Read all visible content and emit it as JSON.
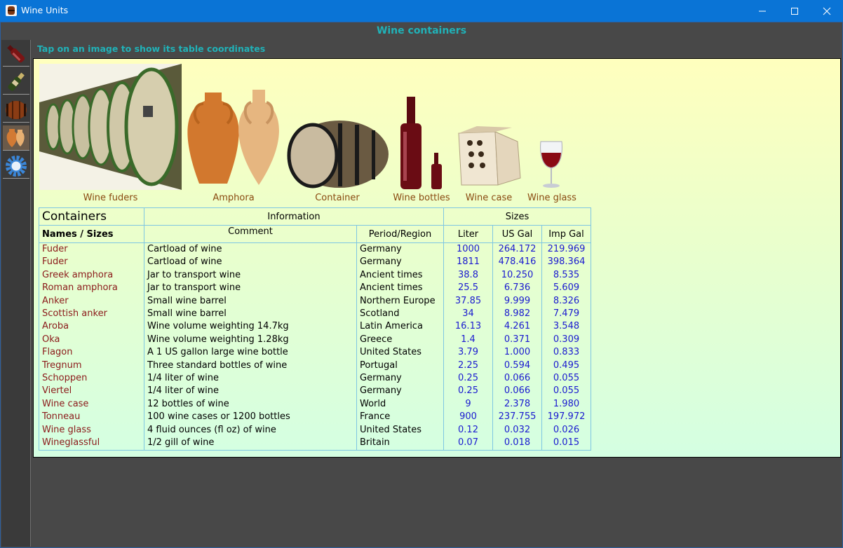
{
  "window": {
    "title": "Wine Units"
  },
  "page": {
    "title": "Wine containers",
    "hint": "Tap on an image to show its table coordinates"
  },
  "sidebar": {
    "items": [
      {
        "icon": "wine-bottle-red-icon"
      },
      {
        "icon": "wine-bottle-green-icon"
      },
      {
        "icon": "barrel-icon"
      },
      {
        "icon": "amphora-icon"
      },
      {
        "icon": "settings-gear-icon"
      }
    ]
  },
  "images": [
    {
      "caption": "Wine fuders"
    },
    {
      "caption": "Amphora"
    },
    {
      "caption": "Container"
    },
    {
      "caption": "Wine bottles"
    },
    {
      "caption": "Wine case"
    },
    {
      "caption": "Wine glass"
    }
  ],
  "table": {
    "group_headers": {
      "containers": "Containers",
      "information": "Information",
      "sizes": "Sizes"
    },
    "columns": {
      "names": "Names / Sizes",
      "comment": "Comment",
      "period": "Period/Region",
      "liter": "Liter",
      "usgal": "US Gal",
      "impgal": "Imp Gal"
    },
    "rows": [
      {
        "name": "Fuder",
        "comment": "Cartload of wine",
        "period": "Germany",
        "liter": "1000",
        "usgal": "264.172",
        "impgal": "219.969"
      },
      {
        "name": "Fuder",
        "comment": "Cartload of wine",
        "period": "Germany",
        "liter": "1811",
        "usgal": "478.416",
        "impgal": "398.364"
      },
      {
        "name": "Greek amphora",
        "comment": "Jar to transport wine",
        "period": "Ancient times",
        "liter": "38.8",
        "usgal": "10.250",
        "impgal": "8.535"
      },
      {
        "name": "Roman amphora",
        "comment": "Jar to transport wine",
        "period": "Ancient times",
        "liter": "25.5",
        "usgal": "6.736",
        "impgal": "5.609"
      },
      {
        "name": "Anker",
        "comment": "Small wine barrel",
        "period": "Northern Europe",
        "liter": "37.85",
        "usgal": "9.999",
        "impgal": "8.326"
      },
      {
        "name": "Scottish anker",
        "comment": "Small wine barrel",
        "period": "Scotland",
        "liter": "34",
        "usgal": "8.982",
        "impgal": "7.479"
      },
      {
        "name": "Aroba",
        "comment": "Wine volume weighting 14.7kg",
        "period": "Latin America",
        "liter": "16.13",
        "usgal": "4.261",
        "impgal": "3.548"
      },
      {
        "name": "Oka",
        "comment": "Wine volume weighting 1.28kg",
        "period": "Greece",
        "liter": "1.4",
        "usgal": "0.371",
        "impgal": "0.309"
      },
      {
        "name": "Flagon",
        "comment": "A 1 US gallon large wine bottle",
        "period": "United States",
        "liter": "3.79",
        "usgal": "1.000",
        "impgal": "0.833"
      },
      {
        "name": "Tregnum",
        "comment": "Three standard bottles of wine",
        "period": "Portugal",
        "liter": "2.25",
        "usgal": "0.594",
        "impgal": "0.495"
      },
      {
        "name": "Schoppen",
        "comment": "1/4 liter of wine",
        "period": "Germany",
        "liter": "0.25",
        "usgal": "0.066",
        "impgal": "0.055"
      },
      {
        "name": "Viertel",
        "comment": "1/4 liter of wine",
        "period": "Germany",
        "liter": "0.25",
        "usgal": "0.066",
        "impgal": "0.055"
      },
      {
        "name": "Wine case",
        "comment": "12 bottles of wine",
        "period": "World",
        "liter": "9",
        "usgal": "2.378",
        "impgal": "1.980"
      },
      {
        "name": "Tonneau",
        "comment": "100 wine cases or 1200 bottles",
        "period": "France",
        "liter": "900",
        "usgal": "237.755",
        "impgal": "197.972"
      },
      {
        "name": "Wine glass",
        "comment": "4 fluid ounces (fl oz) of wine",
        "period": "United States",
        "liter": "0.12",
        "usgal": "0.032",
        "impgal": "0.026"
      },
      {
        "name": "Wineglassful",
        "comment": "1/2 gill of wine",
        "period": "Britain",
        "liter": "0.07",
        "usgal": "0.018",
        "impgal": "0.015"
      }
    ]
  }
}
